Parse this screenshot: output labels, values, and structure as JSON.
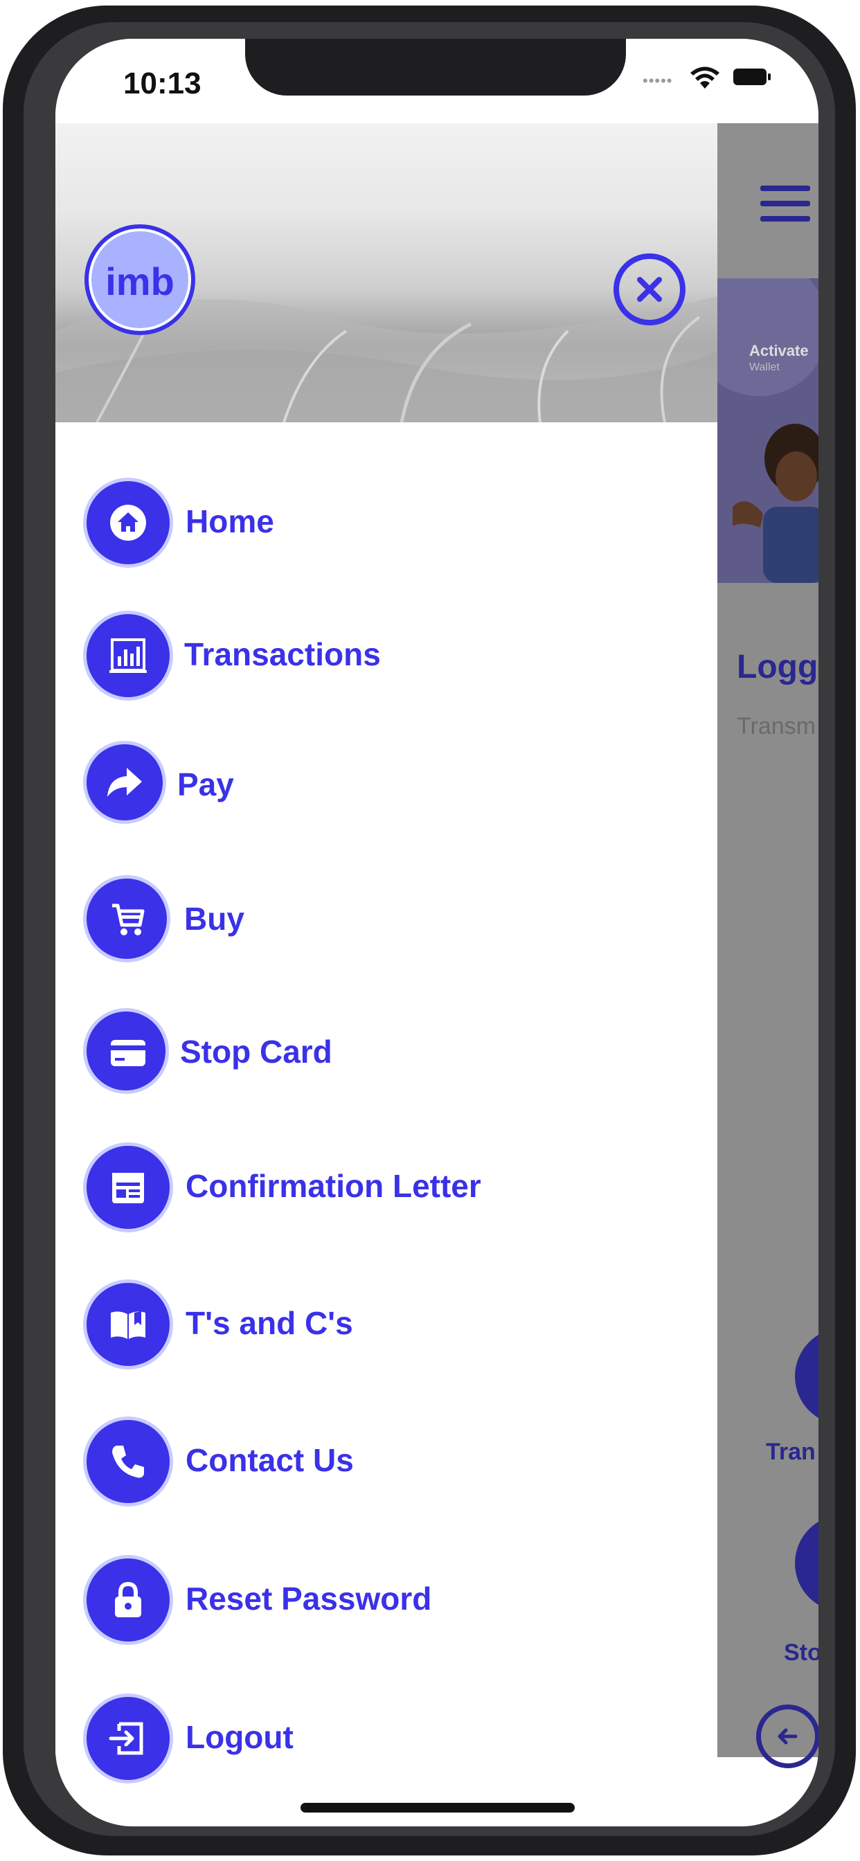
{
  "status_bar": {
    "time": "10:13"
  },
  "drawer": {
    "logo_text": "imb",
    "menu": [
      {
        "label": "Home",
        "icon": "home-icon"
      },
      {
        "label": "Transactions",
        "icon": "bar-chart-icon"
      },
      {
        "label": "Pay",
        "icon": "share-arrow-icon"
      },
      {
        "label": "Buy",
        "icon": "cart-icon"
      },
      {
        "label": "Stop Card",
        "icon": "credit-card-icon"
      },
      {
        "label": "Confirmation Letter",
        "icon": "calendar-icon"
      },
      {
        "label": "T's and C's",
        "icon": "book-icon"
      },
      {
        "label": "Contact Us",
        "icon": "phone-icon"
      },
      {
        "label": "Reset Password",
        "icon": "lock-icon"
      },
      {
        "label": "Logout",
        "icon": "logout-icon"
      }
    ]
  },
  "background_app": {
    "banner_title": "Activate",
    "banner_subtitle": "Wallet",
    "title": "Logge",
    "subtitle": "Transm",
    "button_1_label": "Tran",
    "button_2_label": "Sto"
  },
  "colors": {
    "accent": "#3a31e8",
    "dim_overlay": "#8c8c8c"
  }
}
